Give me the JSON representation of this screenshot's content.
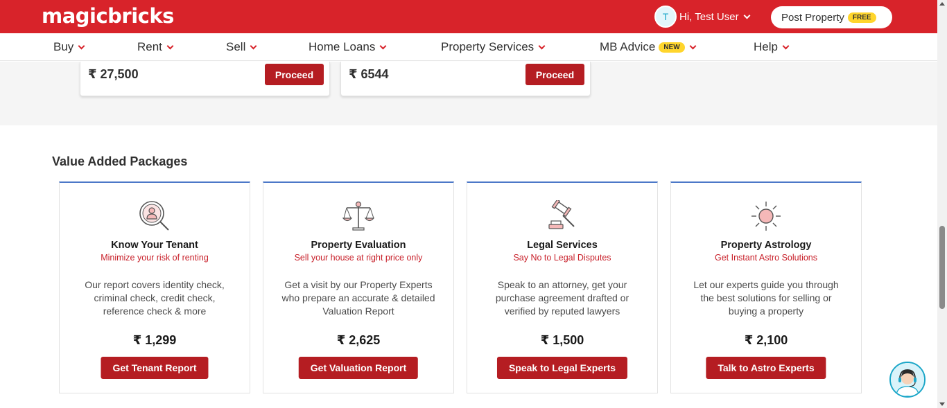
{
  "header": {
    "logo": "magicbricks",
    "user": {
      "initial": "T",
      "greeting": "Hi, Test User"
    },
    "post_property": {
      "label": "Post Property",
      "badge": "FREE"
    }
  },
  "nav": {
    "items": [
      {
        "label": "Buy"
      },
      {
        "label": "Rent"
      },
      {
        "label": "Sell"
      },
      {
        "label": "Home Loans"
      },
      {
        "label": "Property Services"
      },
      {
        "label": "MB Advice",
        "badge": "NEW"
      },
      {
        "label": "Help"
      }
    ]
  },
  "plans": [
    {
      "price": "₹ 27,500",
      "button": "Proceed"
    },
    {
      "price": "₹ 6544",
      "button": "Proceed"
    }
  ],
  "packages": {
    "title": "Value Added Packages",
    "items": [
      {
        "icon": "tenant-search-icon",
        "title": "Know Your Tenant",
        "subtitle": "Minimize your risk of renting",
        "desc": "Our report covers identity check, criminal check, credit check, reference check & more",
        "price": "₹ 1,299",
        "button": "Get Tenant Report"
      },
      {
        "icon": "scales-icon",
        "title": "Property Evaluation",
        "subtitle": "Sell your house at right price only",
        "desc": "Get a visit by our Property Experts who prepare an accurate & detailed Valuation Report",
        "price": "₹ 2,625",
        "button": "Get Valuation Report"
      },
      {
        "icon": "gavel-icon",
        "title": "Legal Services",
        "subtitle": "Say No to Legal Disputes",
        "desc": "Speak to an attorney, get your purchase agreement drafted or verified by reputed lawyers",
        "price": "₹ 1,500",
        "button": "Speak to Legal Experts"
      },
      {
        "icon": "sun-icon",
        "title": "Property Astrology",
        "subtitle": "Get Instant Astro Solutions",
        "desc": "Let our experts guide you through the best solutions for selling or buying a property",
        "price": "₹ 2,100",
        "button": "Talk to Astro Experts"
      }
    ]
  },
  "colors": {
    "brand_red": "#d8232a",
    "button_red": "#b51d22",
    "accent_blue": "#4c78c8",
    "badge_yellow": "#ffd52c"
  }
}
